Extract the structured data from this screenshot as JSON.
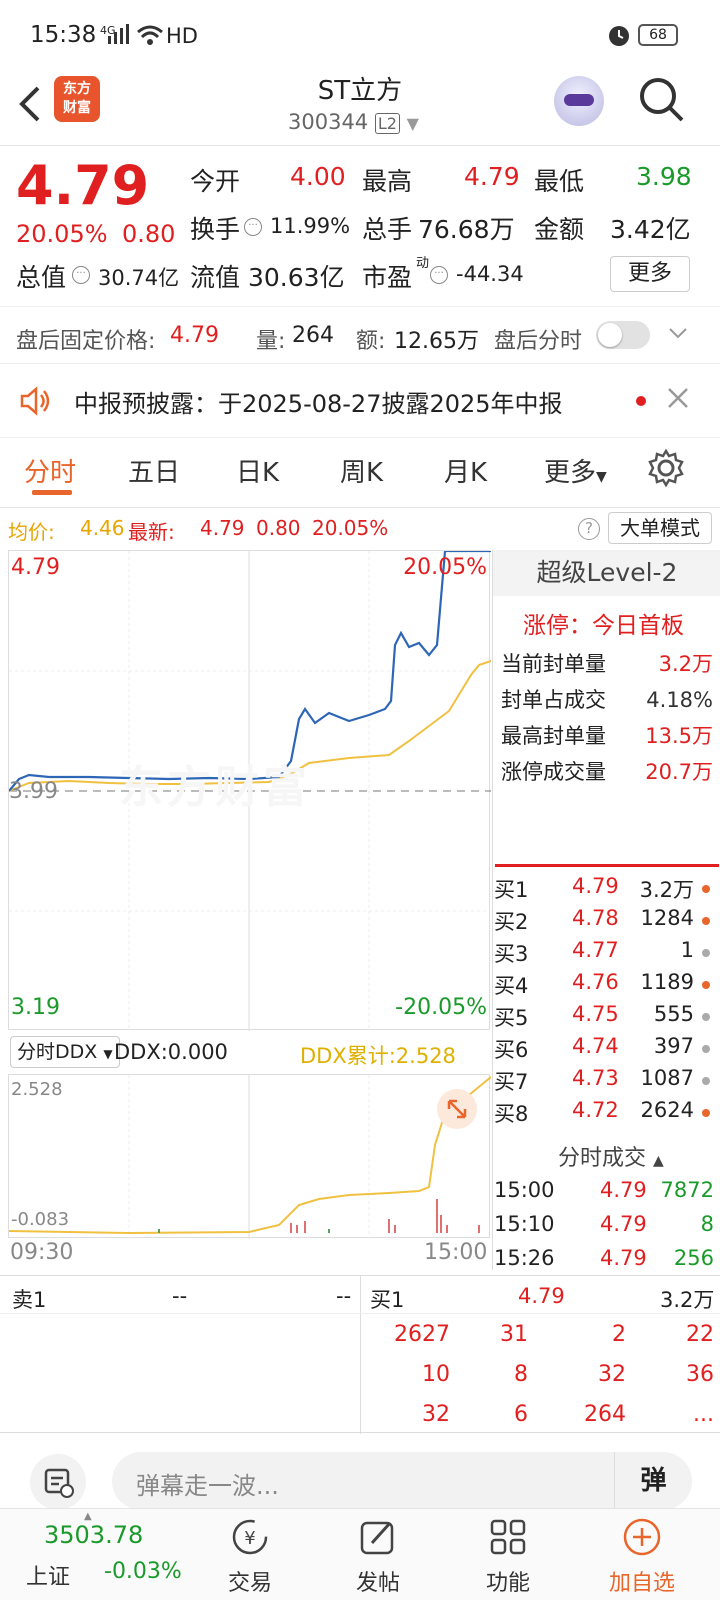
{
  "status": {
    "time": "15:38",
    "net": "4G",
    "hd": "HD",
    "battery": "68"
  },
  "header": {
    "name": "ST立方",
    "code": "300344",
    "level": "L2",
    "logo": "东方财富",
    "icons": {
      "back": "back-icon",
      "search": "search-icon"
    }
  },
  "quote": {
    "price": "4.79",
    "pct": "20.05%",
    "chg": "0.80",
    "open_label": "今开",
    "open": "4.00",
    "high_label": "最高",
    "high": "4.79",
    "low_label": "最低",
    "low": "3.98",
    "turn_label": "换手",
    "turn": "11.99%",
    "vol_label": "总手",
    "vol": "76.68万",
    "amt_label": "金额",
    "amt": "3.42亿",
    "mcap_label": "总值",
    "mcap": "30.74亿",
    "float_label": "流值",
    "float": "30.63亿",
    "pe_label": "市盈",
    "pe_sup": "动",
    "pe": "-44.34",
    "more": "更多"
  },
  "after": {
    "label": "盘后固定价格:",
    "price": "4.79",
    "vol_label": "量:",
    "vol": "264",
    "amt_label": "额:",
    "amt": "12.65万",
    "toggle_label": "盘后分时"
  },
  "notice": {
    "text": "中报预披露：于2025-08-27披露2025年中报"
  },
  "tabs": [
    "分时",
    "五日",
    "日K",
    "周K",
    "月K",
    "更多"
  ],
  "infobar": {
    "avg_label": "均价:",
    "avg": "4.46",
    "last_label": "最新:",
    "last": "4.79",
    "chg": "0.80",
    "pct": "20.05%",
    "mode_btn": "大单模式"
  },
  "chart": {
    "top_price": "4.79",
    "top_pct": "20.05%",
    "base": "3.99",
    "bottom_price": "3.19",
    "bottom_pct": "-20.05%",
    "watermark": "东方财富",
    "ddx_select": "分时DDX",
    "ddx_value": "DDX:0.000",
    "ddx_sum": "DDX累计:2.528",
    "ddx_top": "2.528",
    "ddx_bottom": "-0.083",
    "time_start": "09:30",
    "time_end": "15:00"
  },
  "level2": {
    "title": "超级Level-2",
    "limit": "涨停：今日首板",
    "rows": [
      {
        "label": "当前封单量",
        "value": "3.2万",
        "color": "red"
      },
      {
        "label": "封单占成交",
        "value": "4.18%",
        "color": "dark"
      },
      {
        "label": "最高封单量",
        "value": "13.5万",
        "color": "red"
      },
      {
        "label": "涨停成交量",
        "value": "20.7万",
        "color": "red"
      }
    ]
  },
  "bids": [
    {
      "label": "买1",
      "price": "4.79",
      "vol": "3.2万",
      "dot": "#e8652b"
    },
    {
      "label": "买2",
      "price": "4.78",
      "vol": "1284",
      "dot": "#e8652b"
    },
    {
      "label": "买3",
      "price": "4.77",
      "vol": "1",
      "dot": "#aaa"
    },
    {
      "label": "买4",
      "price": "4.76",
      "vol": "1189",
      "dot": "#e8652b"
    },
    {
      "label": "买5",
      "price": "4.75",
      "vol": "555",
      "dot": "#aaa"
    },
    {
      "label": "买6",
      "price": "4.74",
      "vol": "397",
      "dot": "#aaa"
    },
    {
      "label": "买7",
      "price": "4.73",
      "vol": "1087",
      "dot": "#aaa"
    },
    {
      "label": "买8",
      "price": "4.72",
      "vol": "2624",
      "dot": "#e8652b"
    }
  ],
  "trades_title": "分时成交",
  "trades": [
    {
      "t": "15:00",
      "p": "4.79",
      "v": "7872"
    },
    {
      "t": "15:10",
      "p": "4.79",
      "v": "8"
    },
    {
      "t": "15:26",
      "p": "4.79",
      "v": "256"
    }
  ],
  "queue": {
    "sell_label": "卖1",
    "sell_price": "--",
    "sell_vol": "--",
    "buy_label": "买1",
    "buy_price": "4.79",
    "buy_vol": "3.2万",
    "cells": [
      [
        "2627",
        "31",
        "2",
        "22"
      ],
      [
        "10",
        "8",
        "32",
        "36"
      ],
      [
        "32",
        "6",
        "264",
        "..."
      ]
    ]
  },
  "comment": {
    "placeholder": "弹幕走一波...",
    "danmu": "弹"
  },
  "nav": {
    "index_value": "3503.78",
    "index_name": "上证",
    "index_pct": "-0.03%",
    "trade": "交易",
    "post": "发帖",
    "func": "功能",
    "fav": "加自选"
  }
}
